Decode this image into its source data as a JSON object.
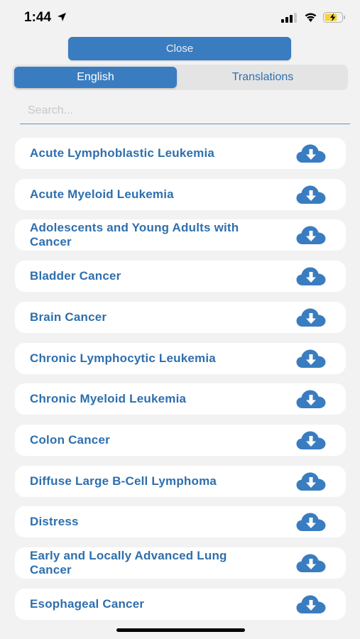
{
  "status": {
    "time": "1:44"
  },
  "close_label": "Close",
  "tabs": {
    "english": "English",
    "translations": "Translations"
  },
  "search": {
    "placeholder": "Search...",
    "value": ""
  },
  "items": [
    {
      "label": "Acute Lymphoblastic Leukemia"
    },
    {
      "label": "Acute Myeloid Leukemia"
    },
    {
      "label": "Adolescents and Young Adults with Cancer"
    },
    {
      "label": "Bladder Cancer"
    },
    {
      "label": "Brain Cancer"
    },
    {
      "label": "Chronic Lymphocytic Leukemia"
    },
    {
      "label": "Chronic Myeloid Leukemia"
    },
    {
      "label": "Colon Cancer"
    },
    {
      "label": "Diffuse Large B-Cell Lymphoma"
    },
    {
      "label": "Distress"
    },
    {
      "label": "Early and Locally Advanced Lung Cancer"
    },
    {
      "label": "Esophageal Cancer"
    }
  ],
  "icons": {
    "download": "download-cloud-icon"
  },
  "colors": {
    "accent": "#3a7cc0",
    "label": "#2e6fad",
    "background": "#f2f2f2",
    "battery": "#f7d33a"
  }
}
